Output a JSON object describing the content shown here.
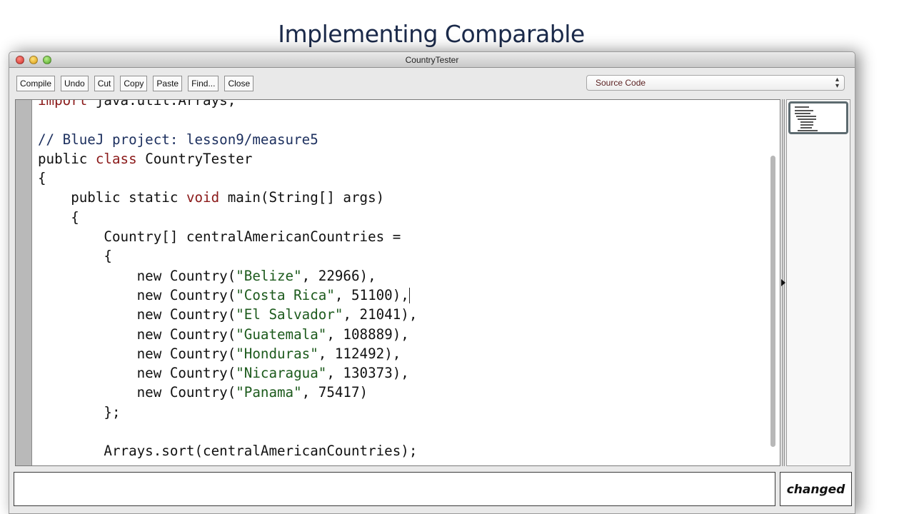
{
  "slide": {
    "title": "Implementing Comparable"
  },
  "window": {
    "title": "CountryTester",
    "controls": [
      "close",
      "minimize",
      "zoom"
    ]
  },
  "toolbar": {
    "buttons": [
      "Compile",
      "Undo",
      "Cut",
      "Copy",
      "Paste",
      "Find...",
      "Close"
    ]
  },
  "view_selector": {
    "selected": "Source Code",
    "icon": "updown-chevron-icon"
  },
  "editor": {
    "lines": [
      [
        {
          "t": "import",
          "c": "kw"
        },
        {
          "t": " java.util.Arrays;"
        }
      ],
      [],
      [
        {
          "t": "// BlueJ project: lesson9/measure5",
          "c": "cm"
        }
      ],
      [
        {
          "t": "public "
        },
        {
          "t": "class",
          "c": "kw"
        },
        {
          "t": " CountryTester"
        }
      ],
      [
        {
          "t": "{"
        }
      ],
      [
        {
          "t": "    public static "
        },
        {
          "t": "void",
          "c": "kw"
        },
        {
          "t": " main(String[] args)"
        }
      ],
      [
        {
          "t": "    {"
        }
      ],
      [
        {
          "t": "        Country[] centralAmericanCountries ="
        }
      ],
      [
        {
          "t": "        {"
        }
      ],
      [
        {
          "t": "            new Country("
        },
        {
          "t": "\"Belize\"",
          "c": "st"
        },
        {
          "t": ", 22966),"
        }
      ],
      [
        {
          "t": "            new Country("
        },
        {
          "t": "\"Costa Rica\"",
          "c": "st"
        },
        {
          "t": ", 51100),"
        },
        {
          "cursor": true
        }
      ],
      [
        {
          "t": "            new Country("
        },
        {
          "t": "\"El Salvador\"",
          "c": "st"
        },
        {
          "t": ", 21041),"
        }
      ],
      [
        {
          "t": "            new Country("
        },
        {
          "t": "\"Guatemala\"",
          "c": "st"
        },
        {
          "t": ", 108889),"
        }
      ],
      [
        {
          "t": "            new Country("
        },
        {
          "t": "\"Honduras\"",
          "c": "st"
        },
        {
          "t": ", 112492),"
        }
      ],
      [
        {
          "t": "            new Country("
        },
        {
          "t": "\"Nicaragua\"",
          "c": "st"
        },
        {
          "t": ", 130373),"
        }
      ],
      [
        {
          "t": "            new Country("
        },
        {
          "t": "\"Panama\"",
          "c": "st"
        },
        {
          "t": ", 75417)"
        }
      ],
      [
        {
          "t": "        };"
        }
      ],
      [],
      [
        {
          "t": "        Arrays.sort(centralAmericanCountries);"
        }
      ]
    ]
  },
  "status": {
    "message": "",
    "state": "changed"
  },
  "colors": {
    "keyword": "#8b1a1a",
    "comment": "#1c2f5e",
    "string": "#1c5a1c",
    "title": "#1b2a4a"
  }
}
